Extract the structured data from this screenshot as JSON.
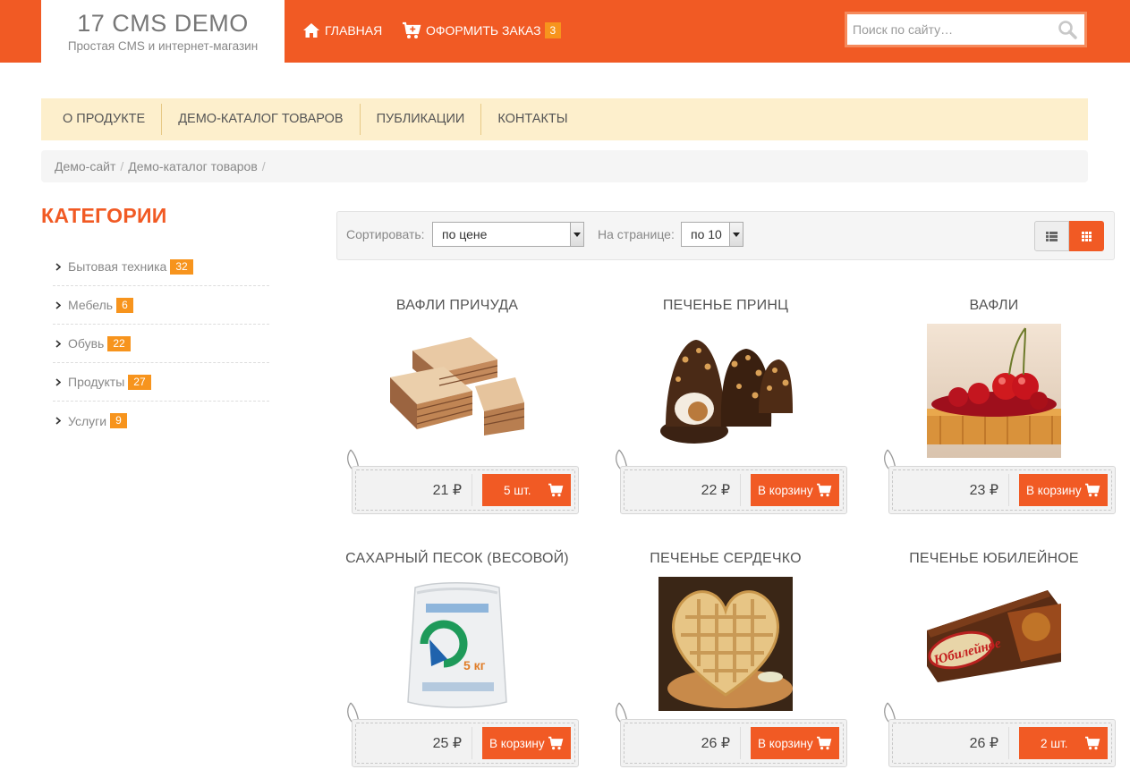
{
  "header": {
    "logo_title": "17 CMS DEMO",
    "logo_subtitle": "Простая CMS и интернет-магазин",
    "nav_home": "ГЛАВНАЯ",
    "nav_order": "ОФОРМИТЬ ЗАКАЗ",
    "cart_count": "3",
    "search_placeholder": "Поиск по сайту…"
  },
  "menu": {
    "items": [
      {
        "label": "О ПРОДУКТЕ"
      },
      {
        "label": "ДЕМО-КАТАЛОГ ТОВАРОВ"
      },
      {
        "label": "ПУБЛИКАЦИИ"
      },
      {
        "label": "КОНТАКТЫ"
      }
    ]
  },
  "breadcrumb": {
    "items": [
      {
        "label": "Демо-сайт"
      },
      {
        "label": "Демо-каталог товаров"
      }
    ],
    "separator": "/"
  },
  "sidebar": {
    "title": "КАТЕГОРИИ",
    "categories": [
      {
        "label": "Бытовая техника",
        "count": "32"
      },
      {
        "label": "Мебель",
        "count": "6"
      },
      {
        "label": "Обувь",
        "count": "22"
      },
      {
        "label": "Продукты",
        "count": "27"
      },
      {
        "label": "Услуги",
        "count": "9"
      }
    ]
  },
  "toolbar": {
    "sort_label": "Сортировать:",
    "sort_value": "по цене",
    "per_page_label": "На странице:",
    "per_page_value": "по 10"
  },
  "products": [
    {
      "title": "ВАФЛИ ПРИЧУДА",
      "price": "21 ₽",
      "button": "5 шт.",
      "image": "wafer-stack"
    },
    {
      "title": "ПЕЧЕНЬЕ ПРИНЦ",
      "price": "22 ₽",
      "button": "В корзину",
      "image": "chocolate-cookies"
    },
    {
      "title": "ВАФЛИ",
      "price": "23 ₽",
      "button": "В корзину",
      "image": "waffle-cherries"
    },
    {
      "title": "САХАРНЫЙ ПЕСОК (ВЕСОВОЙ)",
      "price": "25 ₽",
      "button": "В корзину",
      "image": "sugar-bag"
    },
    {
      "title": "ПЕЧЕНЬЕ СЕРДЕЧКО",
      "price": "26 ₽",
      "button": "В корзину",
      "image": "heart-waffle"
    },
    {
      "title": "ПЕЧЕНЬЕ ЮБИЛЕЙНОЕ",
      "price": "26 ₽",
      "button": "2 шт.",
      "image": "yubileinoe-pack",
      "image_text": "Юбилейное"
    }
  ],
  "colors": {
    "accent": "#f15a24",
    "badge": "#f7941d",
    "menu_bg": "#fdefcc"
  }
}
